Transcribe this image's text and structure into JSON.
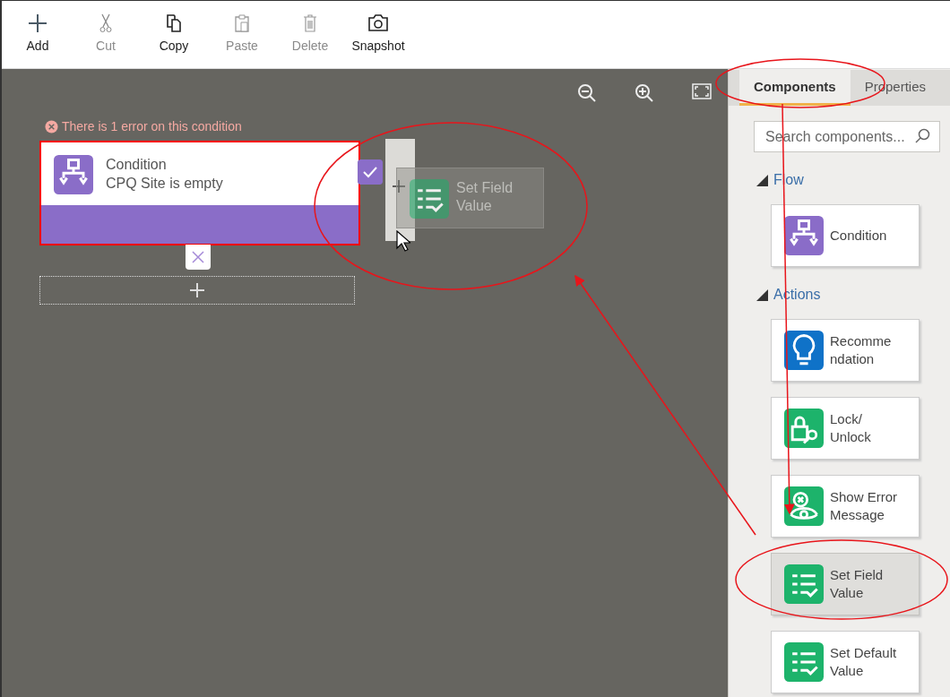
{
  "toolbar": [
    {
      "label": "Add",
      "kind": "add",
      "disabled": false
    },
    {
      "label": "Cut",
      "kind": "cut",
      "disabled": true
    },
    {
      "label": "Copy",
      "kind": "copy",
      "disabled": false
    },
    {
      "label": "Paste",
      "kind": "paste",
      "disabled": true
    },
    {
      "label": "Delete",
      "kind": "delete",
      "disabled": true
    },
    {
      "label": "Snapshot",
      "kind": "snapshot",
      "disabled": false
    }
  ],
  "canvas": {
    "error_message": "There is 1 error on this condition",
    "condition_node": {
      "title": "Condition",
      "subtitle": "CPQ Site is empty"
    },
    "drag_preview": {
      "label": "Set Field Value"
    }
  },
  "panel": {
    "tabs": [
      {
        "label": "Components",
        "selected": true
      },
      {
        "label": "Properties",
        "selected": false
      }
    ],
    "search": {
      "placeholder": "Search components..."
    },
    "sections": [
      {
        "title": "Flow",
        "expanded": true,
        "items": [
          {
            "label": "Condition",
            "kind": "condition",
            "color": "#8a6cc8",
            "selected": false
          }
        ]
      },
      {
        "title": "Actions",
        "expanded": true,
        "items": [
          {
            "label": "Recommendation",
            "kind": "recommendation",
            "color": "#0f72c8",
            "selected": false
          },
          {
            "label": "Lock/ Unlock",
            "kind": "lock",
            "color": "#1db36b",
            "selected": false
          },
          {
            "label": "Show Error Message",
            "kind": "error",
            "color": "#1db36b",
            "selected": false
          },
          {
            "label": "Set Field Value",
            "kind": "setfield",
            "color": "#1db36b",
            "selected": true
          },
          {
            "label": "Set Default Value",
            "kind": "setfield",
            "color": "#1db36b",
            "selected": false
          }
        ]
      }
    ]
  }
}
